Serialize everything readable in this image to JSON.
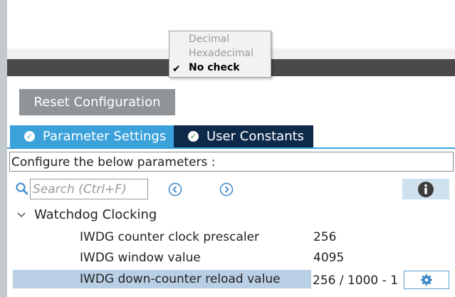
{
  "format_menu": {
    "items": [
      {
        "label": "Decimal",
        "enabled": false,
        "checked": false
      },
      {
        "label": "Hexadecimal",
        "enabled": false,
        "checked": false
      },
      {
        "label": "No check",
        "enabled": true,
        "checked": true
      }
    ]
  },
  "toolbar": {
    "reset_label": "Reset Configuration"
  },
  "tabs": [
    {
      "label": "Parameter Settings",
      "active": true,
      "icon": "check-circle-icon"
    },
    {
      "label": "User Constants",
      "active": false,
      "icon": "check-circle-icon"
    }
  ],
  "config": {
    "description": "Configure the below parameters :"
  },
  "search": {
    "placeholder": "Search (Ctrl+F)",
    "value": ""
  },
  "groups": [
    {
      "label": "Watchdog Clocking",
      "expanded": true,
      "params": [
        {
          "name": "IWDG counter clock prescaler",
          "value": "256",
          "selected": false
        },
        {
          "name": "IWDG window value",
          "value": "4095",
          "selected": false
        },
        {
          "name": "IWDG down-counter reload value",
          "value": "256 / 1000 - 1",
          "selected": true
        }
      ]
    }
  ],
  "colors": {
    "tab_active": "#3aa1da",
    "tab_inactive": "#0e2a4a",
    "reset_button": "#8f9499",
    "selected_row": "#b9cfe6",
    "dark_bar": "#4a4a4a"
  }
}
